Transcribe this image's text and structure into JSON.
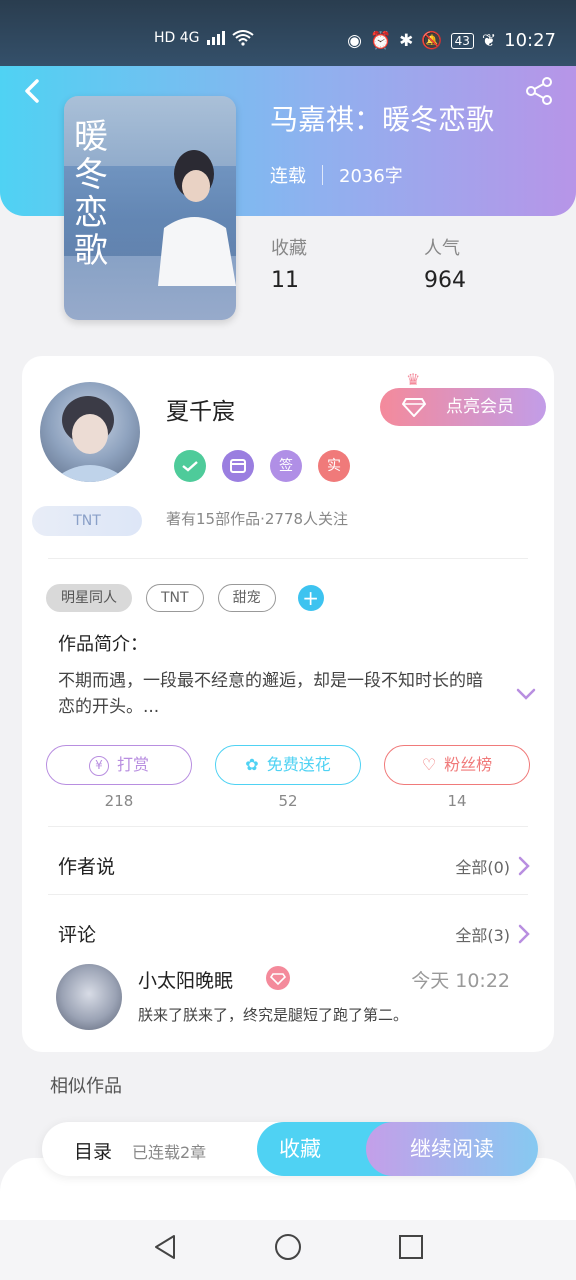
{
  "status_bar": {
    "network": "HD 4G",
    "battery": "43",
    "time": "10:27"
  },
  "book": {
    "title": "马嘉祺：暖冬恋歌",
    "status": "连载",
    "word_count": "2036字",
    "cover_title": "暖冬恋歌",
    "stats": [
      {
        "label": "收藏",
        "value": "11"
      },
      {
        "label": "人气",
        "value": "964"
      }
    ]
  },
  "author": {
    "name": "夏千宸",
    "fan_badge": "TNT",
    "vip_button": "点亮会员",
    "badges": [
      "签",
      "实"
    ],
    "stats": "著有15部作品·2778人关注"
  },
  "tags": [
    "明星同人",
    "TNT",
    "甜宠"
  ],
  "intro": {
    "title": "作品简介：",
    "text": "不期而遇，一段最不经意的邂逅，却是一段不知时长的暗恋的开头。..."
  },
  "actions": [
    {
      "label": "打赏",
      "count": "218",
      "color": "#b88ee0",
      "icon": "yuan-icon"
    },
    {
      "label": "免费送花",
      "count": "52",
      "color": "#4fd2f3",
      "icon": "flower-icon"
    },
    {
      "label": "粉丝榜",
      "count": "14",
      "color": "#f07a7a",
      "icon": "fan-icon"
    }
  ],
  "author_says": {
    "title": "作者说",
    "more": "全部(0)"
  },
  "comments": {
    "title": "评论",
    "more": "全部(3)",
    "items": [
      {
        "name": "小太阳晚眠",
        "time": "今天 10:22",
        "text": "朕来了朕来了，终究是腿短了跑了第二。"
      }
    ]
  },
  "similar": {
    "title": "相似作品"
  },
  "bottom_bar": {
    "toc": "目录",
    "toc_sub": "已连载2章",
    "favorite": "收藏",
    "continue": "继续阅读"
  }
}
